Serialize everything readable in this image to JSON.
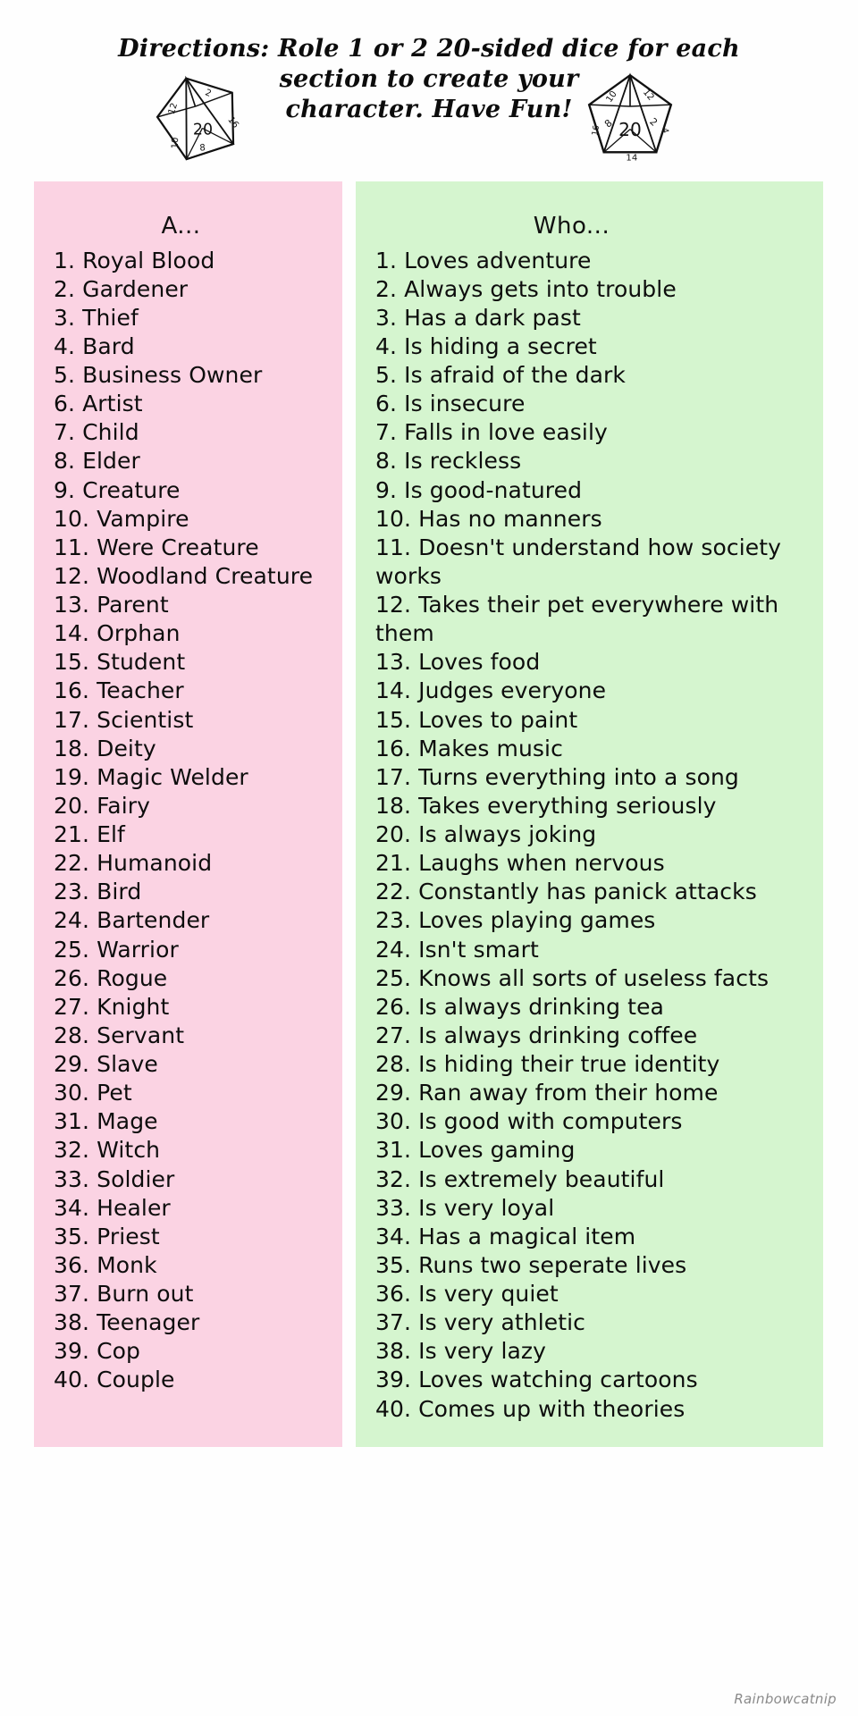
{
  "header": {
    "directions_line1": "Directions: Role 1 or 2 20-sided dice for each section to create your",
    "directions_line2": "character. Have Fun!",
    "dice": [
      {
        "name": "d20-die-left",
        "face_value": "20"
      },
      {
        "name": "d20-die-right",
        "face_value": "20"
      }
    ]
  },
  "columns": [
    {
      "id": "column-a",
      "heading": "A...",
      "background_color": "#fbd3e3",
      "items": [
        "1. Royal Blood",
        "2. Gardener",
        "3. Thief",
        "4. Bard",
        "5. Business Owner",
        "6. Artist",
        "7. Child",
        "8. Elder",
        "9. Creature",
        "10. Vampire",
        "11. Were Creature",
        "12. Woodland Creature",
        "13. Parent",
        "14. Orphan",
        "15. Student",
        "16. Teacher",
        "17. Scientist",
        "18. Deity",
        "19. Magic Welder",
        "20. Fairy",
        "21. Elf",
        "22. Humanoid",
        "23. Bird",
        "24. Bartender",
        "25. Warrior",
        "26. Rogue",
        "27. Knight",
        "28. Servant",
        "29. Slave",
        "30. Pet",
        "31. Mage",
        "32. Witch",
        "33. Soldier",
        "34. Healer",
        "35. Priest",
        "36. Monk",
        "37. Burn out",
        "38. Teenager",
        "39. Cop",
        "40. Couple"
      ]
    },
    {
      "id": "column-who",
      "heading": "Who...",
      "background_color": "#d5f5cf",
      "items": [
        "1. Loves adventure",
        "2. Always gets into trouble",
        "3. Has a dark past",
        "4. Is hiding a secret",
        "5. Is afraid of the dark",
        "6. Is insecure",
        "7. Falls in love easily",
        "8. Is reckless",
        "9. Is good-natured",
        "10. Has no manners",
        "11. Doesn't understand how society works",
        "12. Takes their pet everywhere with them",
        "13. Loves food",
        "14. Judges everyone",
        "15. Loves to paint",
        "16. Makes music",
        "17. Turns everything into a song",
        "18. Takes everything seriously",
        "20. Is always joking",
        "21. Laughs when nervous",
        "22. Constantly has panick attacks",
        "23. Loves playing games",
        "24. Isn't smart",
        "25. Knows all sorts of useless facts",
        "26. Is always drinking tea",
        "27. Is always drinking coffee",
        "28. Is hiding their true identity",
        "29. Ran away from their home",
        "30. Is good with computers",
        "31. Loves gaming",
        "32. Is extremely beautiful",
        "33. Is very loyal",
        "34. Has a magical item",
        "35. Runs two seperate lives",
        "36. Is very quiet",
        "37. Is very athletic",
        "38. Is very lazy",
        "39. Loves watching cartoons",
        "40. Comes up with theories"
      ]
    }
  ],
  "watermark": "Rainbowcatnip"
}
